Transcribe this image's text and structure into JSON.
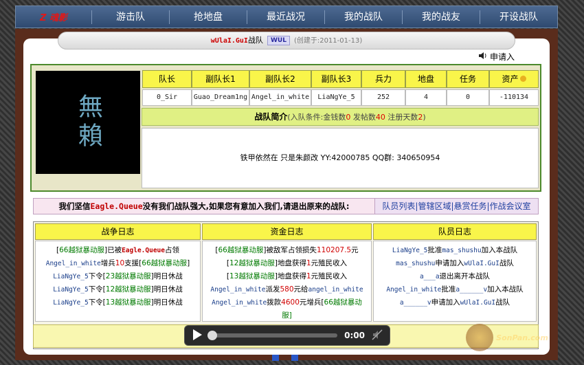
{
  "nav": {
    "logo": "Z 魂影",
    "items": [
      "游击队",
      "抢地盘",
      "最近战况",
      "我的战队",
      "我的战友",
      "开设战队"
    ]
  },
  "team": {
    "name": "wUlaI.GuI",
    "suffix": "战队",
    "logo_text": "WUL",
    "created": "(创建于:2011-01-13)",
    "apply_label": "申请入"
  },
  "avatar_text": "無賴",
  "roster": {
    "headers": [
      "队长",
      "副队长1",
      "副队长2",
      "副队长3",
      "兵力",
      "地盘",
      "任务",
      "资产"
    ],
    "values": [
      "0_Sir",
      "Guao_Dream1ng",
      "Angel_in_white",
      "LiaNgYe_5",
      "252",
      "4",
      "0",
      "-110134"
    ]
  },
  "intro": {
    "title": "战队简介",
    "cond_prefix": "(入队条件:金钱数",
    "money": "0",
    "posts_label": " 发帖数",
    "posts": "40",
    "days_label": " 注册天数",
    "days": "2",
    "cond_suffix": ")",
    "text": "铁甲依然在 只是朱颜改 YY:42000785 QQ群: 340650954"
  },
  "motto": {
    "part1": "我们坚信",
    "highlight": "Eagle.Queue",
    "part2": "没有我们战队强大,如果您有意加入我们,请退出原来的战队:",
    "links": "队员列表|管辖区域|悬赏任务|作战会议室"
  },
  "logs": {
    "war": {
      "title": "战争日志",
      "lines": [
        [
          "[",
          "66越狱暴动服",
          "]已被",
          "Eagle.Queue",
          "占领"
        ],
        [
          "Angel_in_white",
          "增兵",
          "10",
          "支援[",
          "66越狱暴动服",
          "]"
        ],
        [
          "LiaNgYe_5",
          "下令[",
          "23越狱暴动服",
          "]明日休战"
        ],
        [
          "LiaNgYe_5",
          "下令[",
          "12越狱暴动服",
          "]明日休战"
        ],
        [
          "LiaNgYe_5",
          "下令[",
          "13越狱暴动服",
          "]明日休战"
        ]
      ]
    },
    "fund": {
      "title": "资金日志",
      "lines": [
        [
          "[",
          "66越狱暴动服",
          "]被敌军占领损失",
          "110207.5",
          "元"
        ],
        [
          "[",
          "12越狱暴动服",
          "]地盘获得",
          "1",
          "元殖民收入"
        ],
        [
          "[",
          "13越狱暴动服",
          "]地盘获得",
          "1",
          "元殖民收入"
        ],
        [
          "Angel_in_white",
          "派发",
          "580",
          "元给",
          "angel_in_white"
        ],
        [
          "Angel_in_white",
          "拨款",
          "4600",
          "元增兵[",
          "66越狱暴动",
          "服]"
        ]
      ]
    },
    "member": {
      "title": "队员日志",
      "lines": [
        [
          "LiaNgYe_5",
          "批准",
          "mas_shushu",
          "加入本战队"
        ],
        [
          "mas_shushu",
          "申请加入",
          "wUlaI.GuI",
          "战队"
        ],
        [
          "a___a",
          "退出离开本战队"
        ],
        [
          "Angel_in_white",
          "批准",
          "a______v",
          "加入本战队"
        ],
        [
          "a______v",
          "申请加入",
          "wUlaI.GuI",
          "战队"
        ]
      ]
    }
  },
  "player": {
    "time": "0:00",
    "progress": 0
  },
  "watermark": "SonPan.com",
  "colors": {
    "nav": "#3e5a82",
    "frame": "#5a2c1c",
    "header_yellow": "#f9f54a",
    "accent_red": "#d00000",
    "link_blue": "#2040a0"
  }
}
